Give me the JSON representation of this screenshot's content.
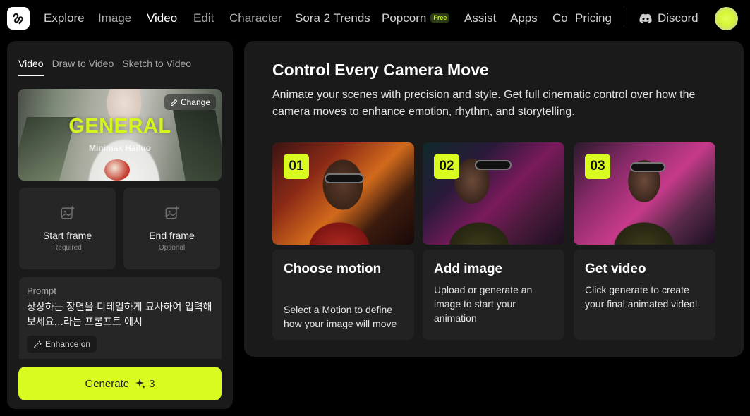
{
  "nav": {
    "items": [
      {
        "label": "Explore"
      },
      {
        "label": "Image"
      },
      {
        "label": "Video"
      },
      {
        "label": "Edit"
      },
      {
        "label": "Character"
      },
      {
        "label": "Sora 2 Trends"
      },
      {
        "label": "Popcorn",
        "badge": "Free"
      },
      {
        "label": "Assist"
      },
      {
        "label": "Apps"
      },
      {
        "label": "Co"
      },
      {
        "label": "Pricing"
      }
    ],
    "active": "Video",
    "discord_label": "Discord"
  },
  "left_panel": {
    "tabs": [
      {
        "label": "Video"
      },
      {
        "label": "Draw to Video"
      },
      {
        "label": "Sketch to Video"
      }
    ],
    "active_tab": "Video",
    "model_card": {
      "title": "GENERAL",
      "subtitle": "Minimax Hailuo",
      "change_label": "Change"
    },
    "start_frame": {
      "label": "Start frame",
      "sublabel": "Required"
    },
    "end_frame": {
      "label": "End frame",
      "sublabel": "Optional"
    },
    "prompt": {
      "label": "Prompt",
      "text": "상상하는 장면을 디테일하게 묘사하여 입력해보세요...라는 프롬프트 예시",
      "enhance_label": "Enhance on"
    },
    "generate": {
      "label": "Generate",
      "cost": "3"
    }
  },
  "right_panel": {
    "title": "Control Every Camera Move",
    "description": "Animate your scenes with precision and style. Get full cinematic control over how the camera moves to enhance emotion, rhythm, and storytelling.",
    "steps": [
      {
        "number": "01",
        "title": "Choose motion",
        "text": "Select a Motion to define how your image will move"
      },
      {
        "number": "02",
        "title": "Add image",
        "text": "Upload or generate an image to start your animation"
      },
      {
        "number": "03",
        "title": "Get video",
        "text": "Click generate to create your final animated video!"
      }
    ]
  },
  "colors": {
    "accent": "#d9fb1f",
    "background": "#000000",
    "panel": "#1a1a1a",
    "card": "#262626"
  }
}
